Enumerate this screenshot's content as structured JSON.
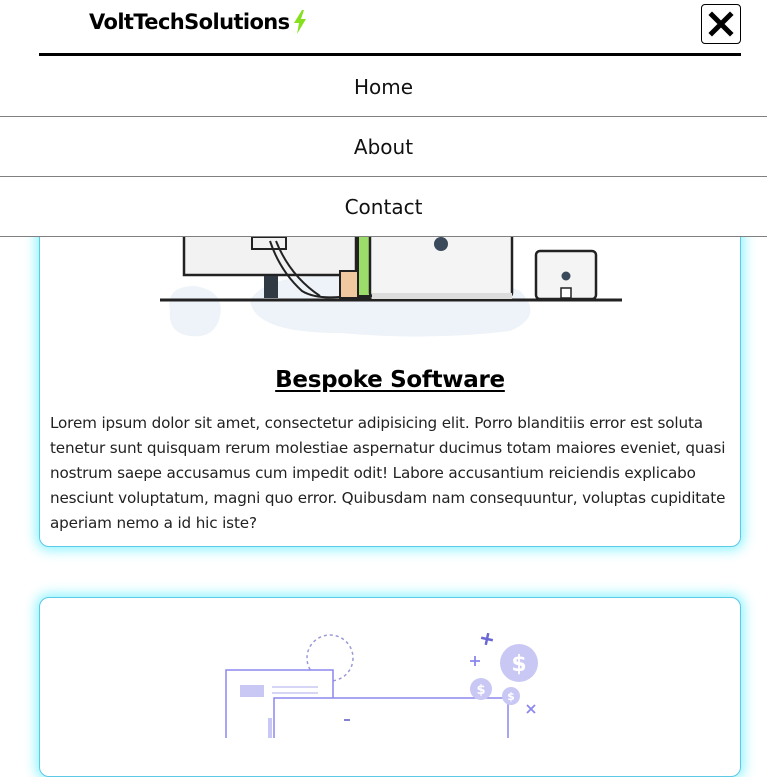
{
  "header": {
    "brand": "VoltTechSolutions",
    "brand_icon": "lightning-bolt-icon",
    "close_icon": "close-x-icon",
    "bolt_color": "#86e01e"
  },
  "nav": {
    "items": [
      {
        "label": "Home"
      },
      {
        "label": "About"
      },
      {
        "label": "Contact"
      }
    ]
  },
  "cards": [
    {
      "title": "Bespoke Software",
      "illustration": "developer-at-desk-illustration",
      "body": "Lorem ipsum dolor sit amet, consectetur adipisicing elit. Porro blanditiis error est soluta tenetur sunt quisquam rerum molestiae aspernatur ducimus totam maiores eveniet, quasi nostrum saepe accusamus cum impedit odit! Labore accusantium reiciendis explicabo nesciunt voluptatum, magni quo error. Quibusdam nam consequuntur, voluptas cupiditate aperiam nemo a id hic iste?"
    },
    {
      "illustration": "finance-dollar-coins-illustration"
    }
  ],
  "colors": {
    "card_border": "#5cc9e6",
    "card_glow": "#00e6ff",
    "illustration_accent": "#8b87ee"
  }
}
